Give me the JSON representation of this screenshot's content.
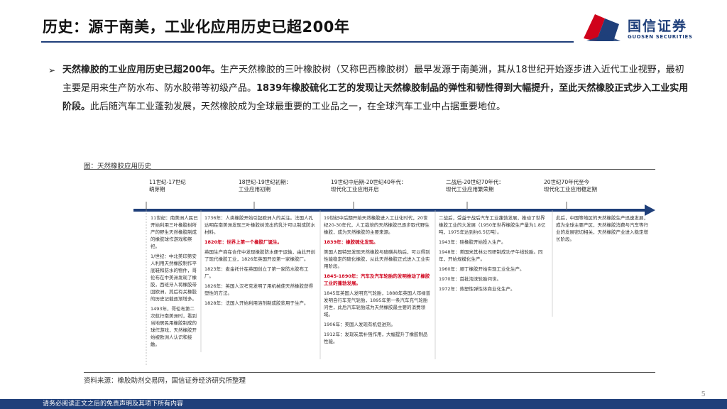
{
  "header": {
    "title": "历史：源于南美，工业化应用历史已超200年",
    "logo_cn": "国信证券",
    "logo_en": "GUOSEN SECURITIES"
  },
  "bullet": {
    "bold1": "天然橡胶的工业应用历史已超200年。",
    "text1": "生产天然橡胶的三叶橡胶树（又称巴西橡胶树）最早发源于南美洲，其从18世纪开始逐步进入近代工业视野，最初主要是用来生产防水布、防水胶带等初级产品。",
    "bold2": "1839年橡胶硫化工艺的发现让天然橡胶制品的弹性和韧性得到大幅提升，至此天然橡胶正式步入工业实用阶段。",
    "text2": "此后随汽车工业蓬勃发展，天然橡胶成为全球最重要的工业品之一，在全球汽车工业中占据重要地位。"
  },
  "figure": {
    "title": "图：天然橡胶应用历史",
    "source": "资料来源：橡胶助剂交易网，国信证券经济研究所整理"
  },
  "timeline": {
    "eras": [
      {
        "label": "11世纪-17世纪\n萌芽期"
      },
      {
        "label": "18世纪-19世纪初期：\n工业应用初期"
      },
      {
        "label": "19世纪中后期-20世纪40年代：\n现代化工业应用开启"
      },
      {
        "label": "二战后-20世纪70年代：\n现代工业应用繁荣期"
      },
      {
        "label": "20世纪70年代至今\n现代化工业应用稳定期"
      }
    ],
    "col1": [
      {
        "t": "11世纪：南美洲人民已开始利用三叶橡胶树所产的野生天然橡胶制成的橡胶球作游戏和祭祀。",
        "c": ""
      },
      {
        "t": "1/世纪：中北美印第安人利用天然橡胶制作平底鞋和防水的物件，哥伦布在中美洲发现了橡胶，西班牙人将橡胶带回欧洲，其后有关橡胶的历史记载逐渐增多。",
        "c": ""
      },
      {
        "t": "1493年，哥伦布第二次航行南美洲时，看到当地居民用橡胶制成的球作游戏，天然橡胶开始被欧洲人认识和接触。",
        "c": ""
      }
    ],
    "col2": [
      {
        "t": "1736年：人类橡胶开始引起欧洲人的关注。法国人孔达明在南美洲发现三叶橡胶树流出的乳汁可以制成防水材料。",
        "c": ""
      },
      {
        "t": "1820年：世界上第一个橡胶厂诞生。",
        "c": "red"
      },
      {
        "t": "英国生产商在合作中发现橡胶防水便于运输，由此开创了现代橡胶工业，1826年英国开设第一家橡胶厂。",
        "c": ""
      },
      {
        "t": "1823年：麦金托什在英国创立了第一家防水胶布工厂。",
        "c": ""
      },
      {
        "t": "1826年：英国人汉考克发明了用机械使天然橡胶获得塑性的方法。",
        "c": ""
      },
      {
        "t": "1828年：法国人开始利用溶剂制成胶浆用于生产。",
        "c": ""
      }
    ],
    "col3": [
      {
        "t": "19世纪中后期开始天然橡胶进入工业化时代，20世纪20-30年代，人工栽培的天然橡胶已逐步取代野生橡胶，成为天然橡胶的主要来源。",
        "c": ""
      },
      {
        "t": "1839年：橡胶硫化发现。",
        "c": "red"
      },
      {
        "t": "美国人固特异发现天然橡胶与硫磺共热后，可以得到性能稳定的硫化橡胶，从此天然橡胶正式进入工业实用阶段。",
        "c": ""
      },
      {
        "t": "1845-1890年：汽车及汽车轮胎的发明推动了橡胶工业的蓬勃发展。",
        "c": "red"
      },
      {
        "t": "1845年英国人发明充气轮胎，1888年英国人邓禄普发明自行车充气轮胎，1895年第一条汽车充气轮胎问世，此后汽车轮胎成为天然橡胶最主要的消费领域。",
        "c": ""
      },
      {
        "t": "1906年：美国人发现有机促进剂。",
        "c": ""
      },
      {
        "t": "1912年：发现炭黑补强作用，大幅提升了橡胶制品性能。",
        "c": ""
      }
    ],
    "col4": [
      {
        "t": "二战后，受益于战后汽车工业蓬勃发展，推动了世界橡胶工业的大发展（1950年世界橡胶生产量为1.8亿吨，1975年达到约6.5亿吨）。",
        "c": ""
      },
      {
        "t": "1943年：硅橡胶开始投入生产。",
        "c": ""
      },
      {
        "t": "1948年：美国米其林公司研制成功子午线轮胎。同年，开始规模化生产。",
        "c": ""
      },
      {
        "t": "1960年：顺丁橡胶开始实现工业化生产。",
        "c": ""
      },
      {
        "t": "1970年：首批泡沫轮胎问世。",
        "c": ""
      },
      {
        "t": "1972年：热塑性弹性体商业化生产。",
        "c": ""
      }
    ],
    "col5": [
      {
        "t": "此后，中国等地区的天然橡胶生产迅速发展，成为全球主要产区，天然橡胶消费与汽车等行业的发展密切相关，天然橡胶产业进入稳定增长阶段。",
        "c": ""
      }
    ]
  },
  "page": {
    "number": "5"
  },
  "footer": {
    "text": "请务必阅读正文之后的免责声明及其项下所有内容"
  },
  "colors": {
    "brand_blue": "#1f3f7a",
    "brand_red": "#d0021b"
  }
}
